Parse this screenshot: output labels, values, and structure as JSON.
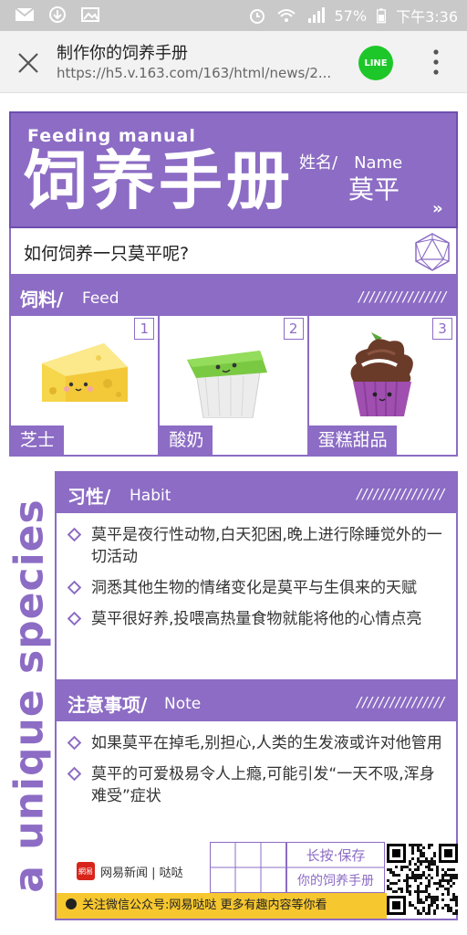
{
  "status_bar": {
    "battery": "57%",
    "time": "下午3:36"
  },
  "browser": {
    "title": "制作你的饲养手册",
    "url": "https://h5.v.163.com/163/html/news/2...",
    "line_label": "LINE"
  },
  "header": {
    "en_title": "Feeding manual",
    "cn_title": "饲养手册",
    "name_label_cn": "姓名/",
    "name_label_en": "Name",
    "name_value": "莫平",
    "chevron": "»"
  },
  "question": "如何饲养一只莫平呢?",
  "feed": {
    "title": "饲料/",
    "en": "Feed",
    "slashes": "////////////////",
    "items": [
      {
        "num": "1",
        "label": "芝士",
        "icon": "cheese-icon"
      },
      {
        "num": "2",
        "label": "酸奶",
        "icon": "yogurt-icon"
      },
      {
        "num": "3",
        "label": "蛋糕甜品",
        "icon": "cupcake-icon"
      }
    ]
  },
  "side_text": "a unique species",
  "habit": {
    "title": "习性/",
    "en": "Habit",
    "slashes": "////////////////",
    "items": [
      "莫平是夜行性动物,白天犯困,晚上进行除睡觉外的一切活动",
      "洞悉其他生物的情绪变化是莫平与生俱来的天赋",
      "莫平很好养,投喂高热量食物就能将他的心情点亮"
    ]
  },
  "note": {
    "title": "注意事项/",
    "en": "Note",
    "slashes": "////////////////",
    "items": [
      "如果莫平在掉毛,别担心,人类的生发液或许对他管用",
      "莫平的可爱极易令人上瘾,可能引发“一天不吸,浑身难受”症状"
    ]
  },
  "footer": {
    "logo_small": "網易",
    "brand": "网易新闻 | 哒哒",
    "save_label": "长按·保存",
    "save_sub": "你的饲养手册",
    "follow_text": "关注微信公众号:网易哒哒 更多有趣内容等你看"
  },
  "colors": {
    "purple": "#8c6cc4",
    "purple_dark": "#6e4fae",
    "yellow": "#f7c72f",
    "line_green": "#1ec729"
  }
}
